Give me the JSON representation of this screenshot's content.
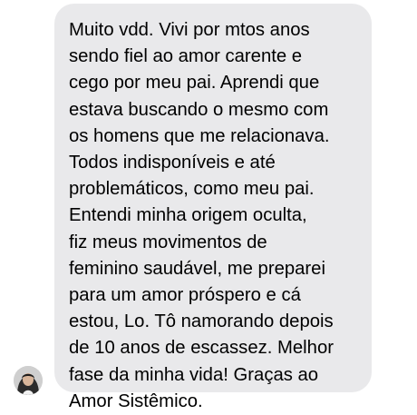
{
  "conversation": {
    "message": {
      "text": "Muito vdd. Vivi por mtos anos\nsendo fiel ao amor carente e\ncego por meu pai. Aprendi que\nestava buscando o mesmo com\nos homens que me relacionava.\nTodos indisponíveis e até\nproblemáticos, como meu pai.\nEntendi minha origem oculta,\nfiz meus movimentos de\nfeminino saudável, me preparei\npara um amor próspero e cá\nestou, Lo. Tô namorando depois\nde 10 anos de escassez. Melhor\nfase da minha vida! Graças ao\nAmor Sistêmico.",
      "bubble_color": "#e9e9eb",
      "text_color": "#000000"
    },
    "sender": {
      "avatar_icon": "profile-photo-icon"
    }
  }
}
